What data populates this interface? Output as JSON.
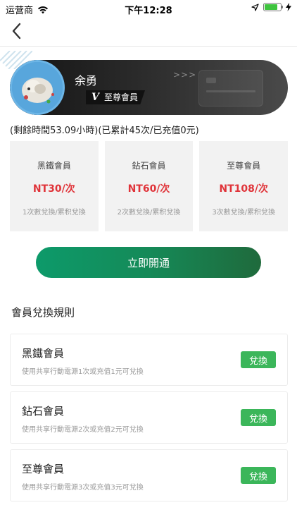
{
  "status_bar": {
    "carrier": "运营商",
    "time": "下午12:28",
    "battery_level": 0.8
  },
  "nav": {
    "back_icon": "chevron-left-icon"
  },
  "member_card": {
    "username": "余勇",
    "tier_badge_mark": "V",
    "tier_badge_label": "至尊會員",
    "arrows": ">>>"
  },
  "summary_text": "(剩餘時間53.09小時)(已累計45次/已充值0元)",
  "tiers": [
    {
      "name": "黑鐵會員",
      "price": "NT30/次",
      "desc": "1次數兌換/累积兌換"
    },
    {
      "name": "鉆石會員",
      "price": "NT60/次",
      "desc": "2次數兌換/累积兌換"
    },
    {
      "name": "至尊會員",
      "price": "NT108/次",
      "desc": "3次數兌換/累积兌換"
    }
  ],
  "activate_label": "立即開通",
  "rules": {
    "title": "會員兌換規則",
    "items": [
      {
        "name": "黑鐵會員",
        "desc": "使用共享行動電源1次或充值1元可兌換",
        "button": "兌換"
      },
      {
        "name": "鉆石會員",
        "desc": "使用共享行動電源2次或充值2元可兌換",
        "button": "兌換"
      },
      {
        "name": "至尊會員",
        "desc": "使用共享行動電源3次或充值3元可兌換",
        "button": "兌換"
      }
    ]
  },
  "colors": {
    "accent_green": "#3bb65a",
    "price_red": "#e0343a",
    "button_gradient_start": "#0d9a6a",
    "button_gradient_end": "#1f6a3c"
  }
}
